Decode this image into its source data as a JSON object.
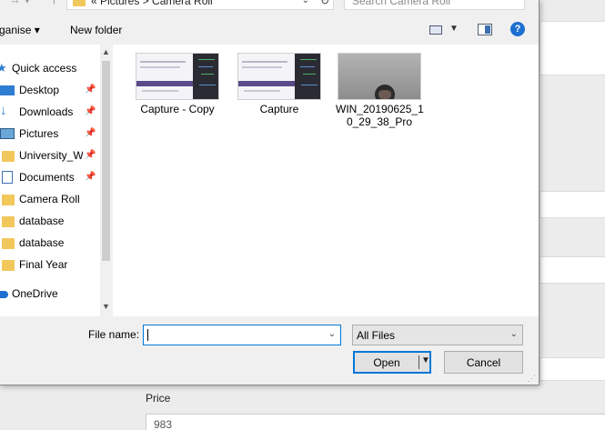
{
  "background_form": {
    "price_label": "Price",
    "price_value": "983"
  },
  "dialog": {
    "address": {
      "path": "«  Pictures  >  Camera Roll",
      "search_placeholder": "Search Camera Roll"
    },
    "toolbar": {
      "organise_label": "ganise ▾",
      "new_folder_label": "New folder"
    },
    "nav": {
      "items": [
        {
          "label": "Quick access",
          "icon": "star-icon",
          "pinned": false
        },
        {
          "label": "Desktop",
          "icon": "desktop-icon",
          "pinned": true
        },
        {
          "label": "Downloads",
          "icon": "download-icon",
          "pinned": true
        },
        {
          "label": "Pictures",
          "icon": "pictures-icon",
          "pinned": true
        },
        {
          "label": "University_W",
          "icon": "folder-icon",
          "pinned": true
        },
        {
          "label": "Documents",
          "icon": "documents-icon",
          "pinned": true
        },
        {
          "label": "Camera Roll",
          "icon": "folder-icon",
          "pinned": false
        },
        {
          "label": "database",
          "icon": "folder-icon",
          "pinned": false
        },
        {
          "label": "database",
          "icon": "folder-icon",
          "pinned": false
        },
        {
          "label": "Final Year",
          "icon": "folder-icon",
          "pinned": false
        },
        {
          "label": "OneDrive",
          "icon": "cloud-icon",
          "pinned": false
        }
      ]
    },
    "files": [
      {
        "label": "Capture - Copy",
        "kind": "screenshot"
      },
      {
        "label": "Capture",
        "kind": "screenshot"
      },
      {
        "label": "WIN_20190625_1\n0_29_38_Pro",
        "kind": "webcam-photo"
      }
    ],
    "footer": {
      "filename_label": "File name:",
      "filename_value": "",
      "filetype_value": "All Files",
      "open_label": "Open",
      "cancel_label": "Cancel"
    }
  },
  "colors": {
    "accent": "#0078d7",
    "folder": "#f2c75c",
    "help": "#1e6fd1"
  }
}
